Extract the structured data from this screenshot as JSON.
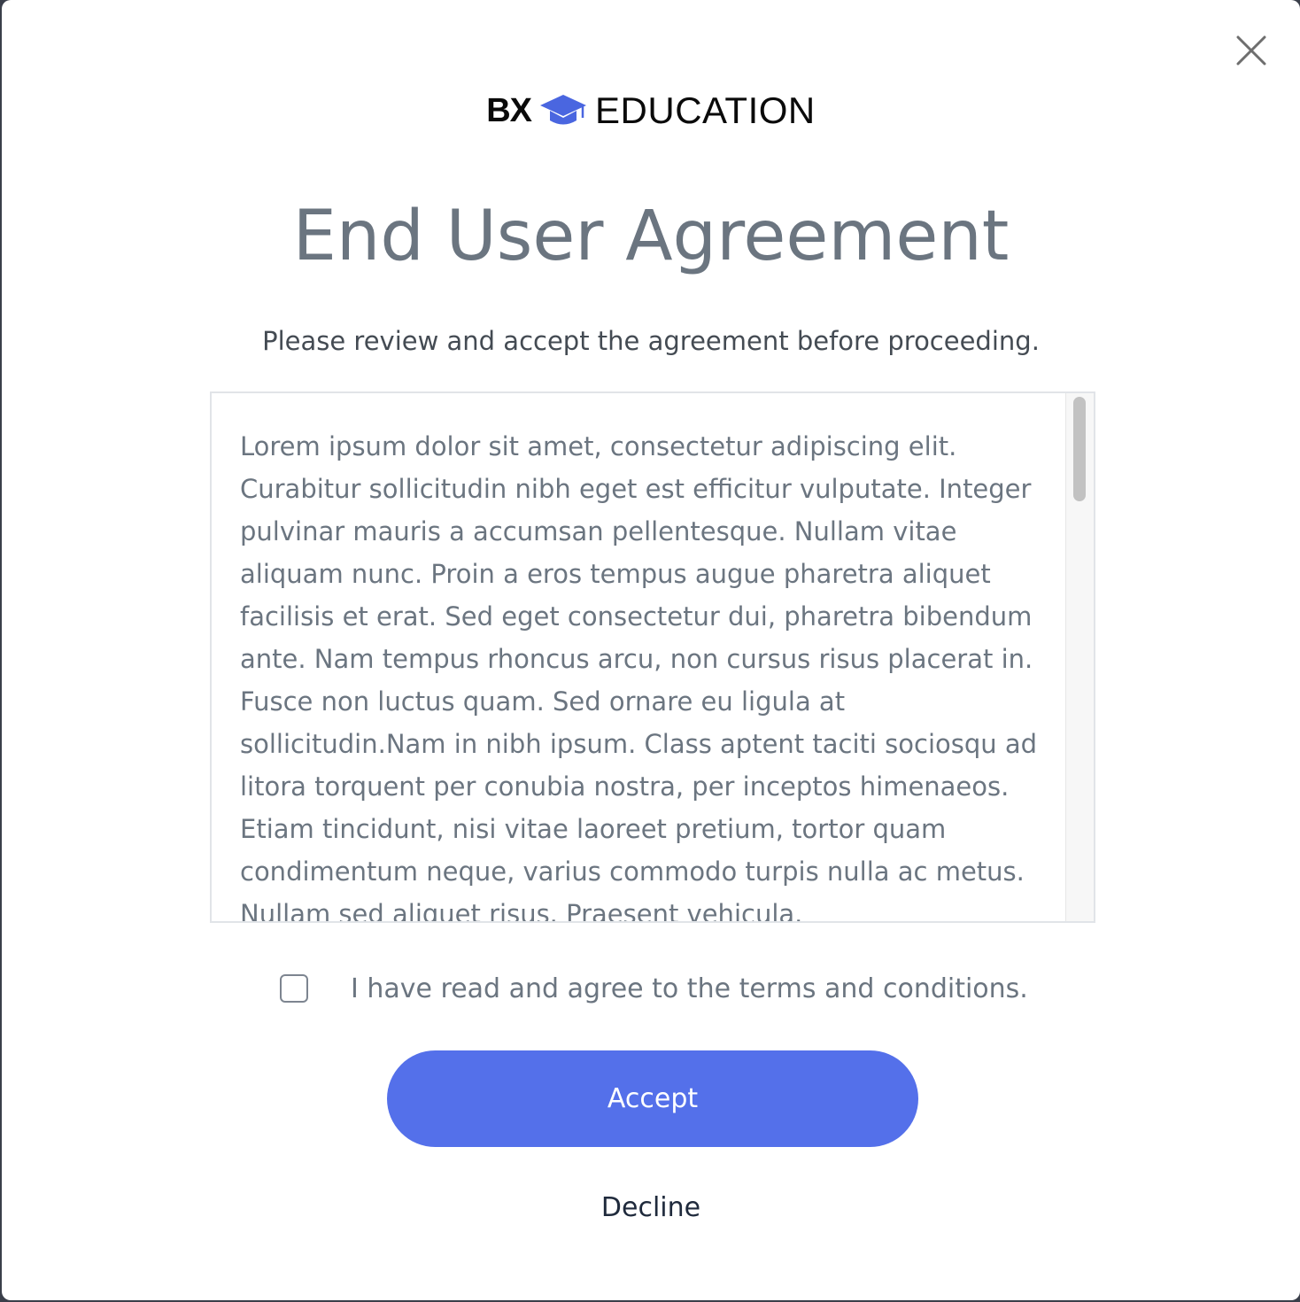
{
  "logo": {
    "brand_mark": "BX",
    "brand_name": "EDUCATION",
    "accent_color": "#4a66e0"
  },
  "dialog": {
    "title": "End User Agreement",
    "subtitle": "Please review and accept the agreement before proceeding.",
    "terms_text": "Lorem ipsum dolor sit amet, consectetur adipiscing elit. Curabitur sollicitudin nibh eget est efficitur vulputate. Integer pulvinar mauris a accumsan pellentesque. Nullam vitae aliquam nunc. Proin a eros tempus augue pharetra aliquet facilisis et erat. Sed eget consectetur dui, pharetra bibendum ante. Nam tempus rhoncus arcu, non cursus risus placerat in. Fusce non luctus quam. Sed ornare eu ligula at sollicitudin.Nam in nibh ipsum. Class aptent taciti sociosqu ad litora torquent per conubia nostra, per inceptos himenaeos. Etiam tincidunt, nisi vitae laoreet pretium, tortor quam condimentum neque, varius commodo turpis nulla ac metus. Nullam sed aliquet risus. Praesent vehicula.",
    "agree_label": "I have read and agree to the terms and conditions.",
    "agree_checked": false,
    "accept_label": "Accept",
    "decline_label": "Decline",
    "close_icon": "close-icon"
  },
  "colors": {
    "primary": "#5470ea",
    "title_text": "#6b7580",
    "decline_text": "#1f2a3c"
  }
}
